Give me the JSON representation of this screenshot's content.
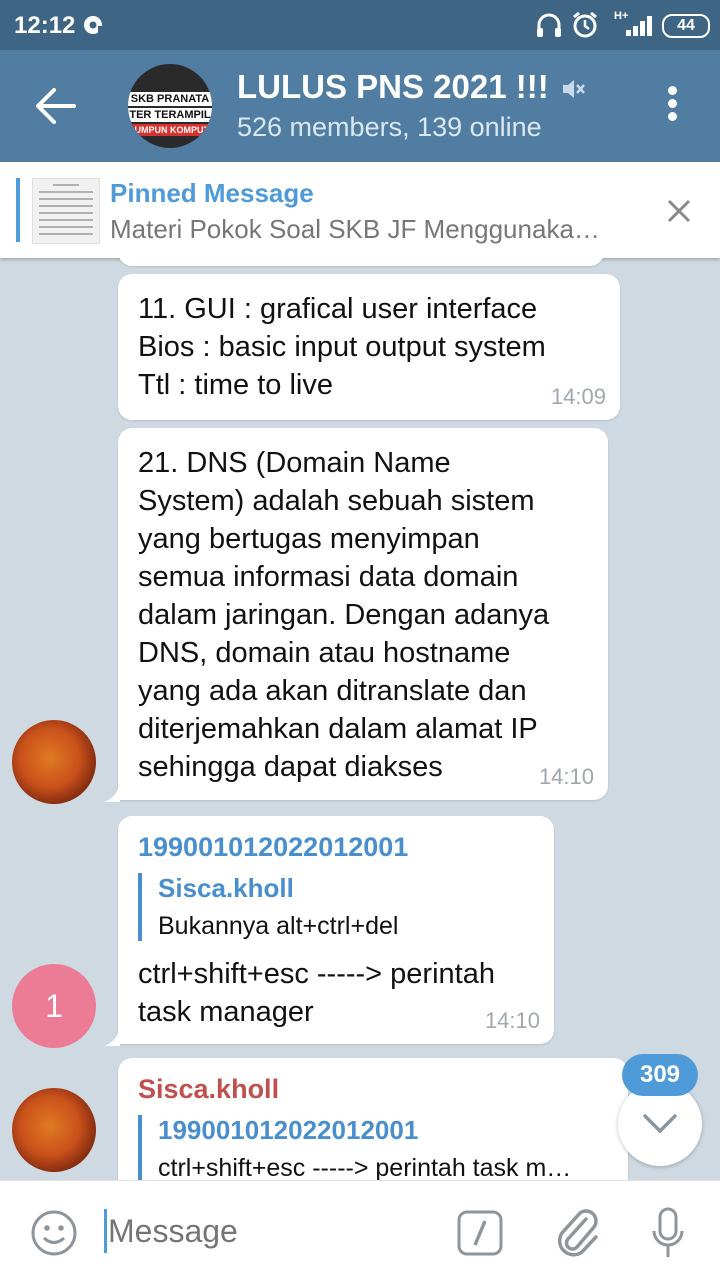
{
  "status_bar": {
    "time": "12:12",
    "battery": "44",
    "network": "H+"
  },
  "header": {
    "title": "LULUS PNS 2021 !!!",
    "subtitle": "526 members, 139 online",
    "avatar_text": [
      "SKB PRANATA",
      "TER TERAMPIL",
      "RUMPUN KOMPUTER"
    ]
  },
  "pinned": {
    "title": "Pinned Message",
    "text": "Materi Pokok Soal SKB JF Menggunaka…"
  },
  "messages": [
    {
      "text_lines": [
        "11. GUI : grafical user interface",
        "Bios : basic input output system",
        "Ttl : time to live"
      ],
      "time": "14:09"
    },
    {
      "text_lines": [
        "21. DNS (Domain Name",
        "System) adalah sebuah sistem",
        "yang bertugas menyimpan",
        "semua informasi data domain",
        "dalam jaringan. Dengan adanya",
        "DNS, domain atau hostname",
        "yang ada akan ditranslate dan",
        "diterjemahkan dalam alamat IP",
        "sehingga dapat diakses"
      ],
      "time": "14:10"
    },
    {
      "sender": "199001012022012001",
      "reply_name": "Sisca.kholl",
      "reply_text": "Bukannya alt+ctrl+del",
      "text_lines": [
        "ctrl+shift+esc -----> perintah",
        "task manager"
      ],
      "time": "14:10",
      "avatar_text": "1"
    },
    {
      "sender": "Sisca.kholl",
      "sender_color": "#c0504d",
      "reply_name": "199001012022012001",
      "reply_text": "ctrl+shift+esc -----> perintah task m…"
    }
  ],
  "scroll_badge": "309",
  "input": {
    "placeholder": "Message"
  },
  "colors": {
    "header": "#517da2",
    "statusbar": "#3f6585",
    "accent": "#4f9ad8",
    "chat_bg": "#cfd9e1"
  }
}
